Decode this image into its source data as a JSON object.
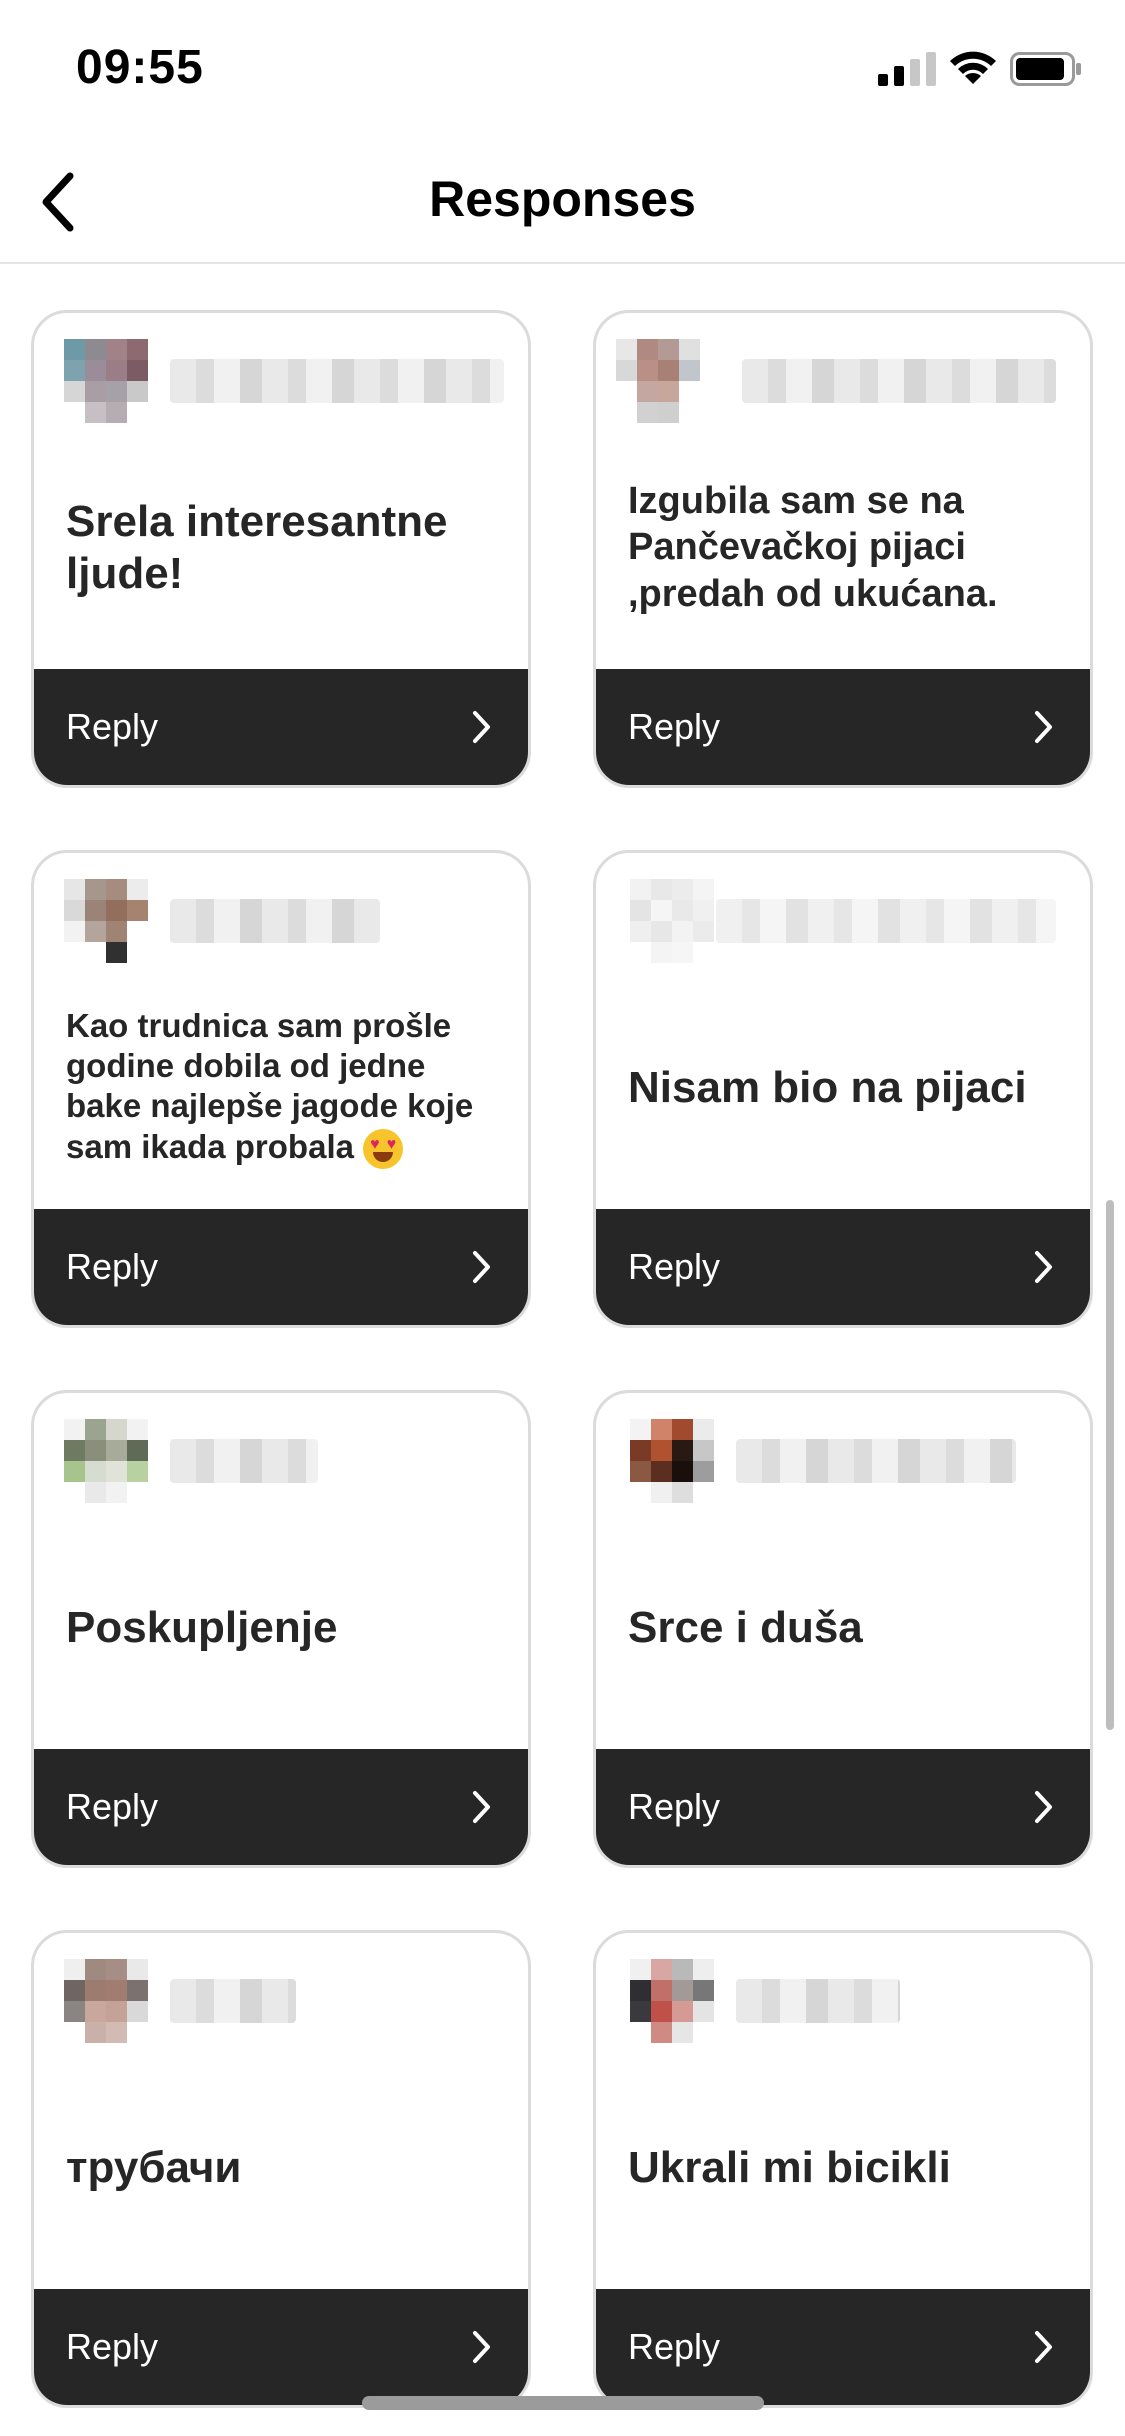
{
  "status_bar": {
    "time": "09:55",
    "signal_icon": "cellular-signal-icon",
    "wifi_icon": "wifi-icon",
    "battery_icon": "battery-icon"
  },
  "nav": {
    "title": "Responses",
    "back_icon": "chevron-left-icon"
  },
  "cards": [
    {
      "text": "Srela interesantne ljude!",
      "reply_label": "Reply"
    },
    {
      "text": "Izgubila sam se na Pančevačkoj pijaci ,predah od ukućana.",
      "reply_label": "Reply"
    },
    {
      "text": "Kao trudnica sam prošle godine dobila od jedne bake najlepše jagode koje sam ikada probala",
      "emoji": "smiling-face-with-heart-eyes-emoji",
      "reply_label": "Reply"
    },
    {
      "text": "Nisam bio na pijaci",
      "reply_label": "Reply"
    },
    {
      "text": "Poskupljenje",
      "reply_label": "Reply"
    },
    {
      "text": "Srce i duša",
      "reply_label": "Reply"
    },
    {
      "text": "трубачи",
      "reply_label": "Reply"
    },
    {
      "text": "Ukrali mi bicikli",
      "reply_label": "Reply"
    }
  ],
  "colors": {
    "reply_bar": "#262626",
    "card_border": "#dbdbdb",
    "text": "#262626"
  }
}
